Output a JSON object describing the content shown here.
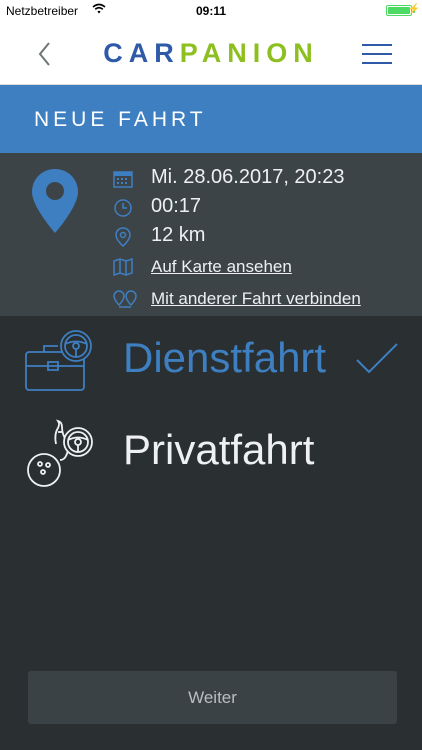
{
  "status_bar": {
    "carrier": "Netzbetreiber",
    "time": "09:11"
  },
  "nav": {
    "brand_car": "CAR",
    "brand_panion": "PANION"
  },
  "title": "NEUE FAHRT",
  "trip": {
    "datetime": "Mi. 28.06.2017, 20:23",
    "duration": "00:17",
    "distance": "12 km",
    "map_link": "Auf Karte ansehen",
    "connect_link": "Mit anderer Fahrt verbinden"
  },
  "options": [
    {
      "label": "Dienstfahrt",
      "icon": "briefcase-wheel-icon",
      "selected": true
    },
    {
      "label": "Privatfahrt",
      "icon": "bowling-wheel-icon",
      "selected": false
    }
  ],
  "next_button": "Weiter",
  "colors": {
    "accent": "#3e7fc1",
    "brand_blue": "#2e5aa8",
    "brand_green": "#8cbf1f",
    "background": "#2a2f32",
    "summary_bg": "#3c4448",
    "battery": "#4cd964"
  }
}
